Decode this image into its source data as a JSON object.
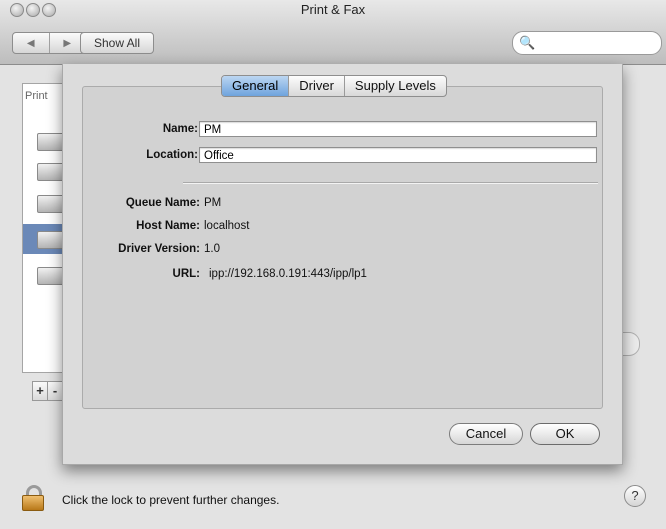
{
  "window": {
    "title": "Print & Fax",
    "show_all_label": "Show All",
    "back_glyph": "◀",
    "forward_glyph": "▶",
    "search_glyph": "🔍"
  },
  "printer_list": {
    "header": "Print",
    "items": [
      {
        "selected": false
      },
      {
        "selected": false
      },
      {
        "selected": false
      },
      {
        "selected": true
      },
      {
        "selected": false
      }
    ]
  },
  "sheet": {
    "tabs": [
      {
        "label": "General",
        "active": true
      },
      {
        "label": "Driver",
        "active": false
      },
      {
        "label": "Supply Levels",
        "active": false
      }
    ],
    "fields": {
      "name_label": "Name:",
      "name_value": "PM",
      "location_label": "Location:",
      "location_value": "Office"
    },
    "info": {
      "queue_name_label": "Queue Name:",
      "queue_name_value": "PM",
      "host_name_label": "Host Name:",
      "host_name_value": "localhost",
      "driver_version_label": "Driver Version:",
      "driver_version_value": "1.0",
      "url_label": "URL:",
      "url_value": "ipp://192.168.0.191:443/ipp/lp1"
    },
    "cancel_label": "Cancel",
    "ok_label": "OK"
  },
  "list_controls": {
    "add_label": "+",
    "remove_label": "-"
  },
  "footer": {
    "lock_text": "Click the lock to prevent further changes.",
    "help_label": "?"
  }
}
